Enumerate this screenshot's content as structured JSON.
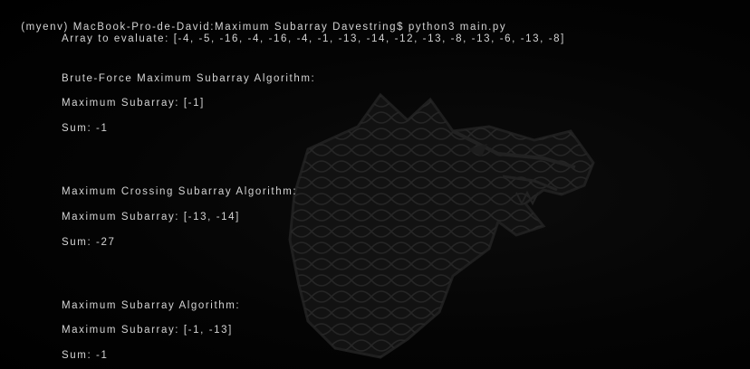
{
  "terminal": {
    "prompt": {
      "env": "(myenv)",
      "host_path": "MacBook-Pro-de-David:Maximum Subarray Davestring$",
      "command": "python3 main.py"
    },
    "array_line": "Array to evaluate: [-4, -5, -16, -4, -16, -4, -1, -13, -14, -12, -13, -8, -13, -6, -13, -8]",
    "brute_force": {
      "title": "Brute-Force Maximum Subarray Algorithm:",
      "subarray": "Maximum Subarray: [-1]",
      "sum": "Sum: -1"
    },
    "crossing": {
      "title": "Maximum Crossing Subarray Algorithm:",
      "subarray": "Maximum Subarray: [-13, -14]",
      "sum": "Sum: -27"
    },
    "maximum": {
      "title": "Maximum Subarray Algorithm:",
      "subarray": "Maximum Subarray: [-1, -13]",
      "sum": "Sum: -1"
    }
  },
  "colors": {
    "background": "#000000",
    "text": "#d4d4d4",
    "watermark": "#1b1b1b"
  },
  "icons": {
    "watermark": "direwolf-emblem-icon"
  }
}
